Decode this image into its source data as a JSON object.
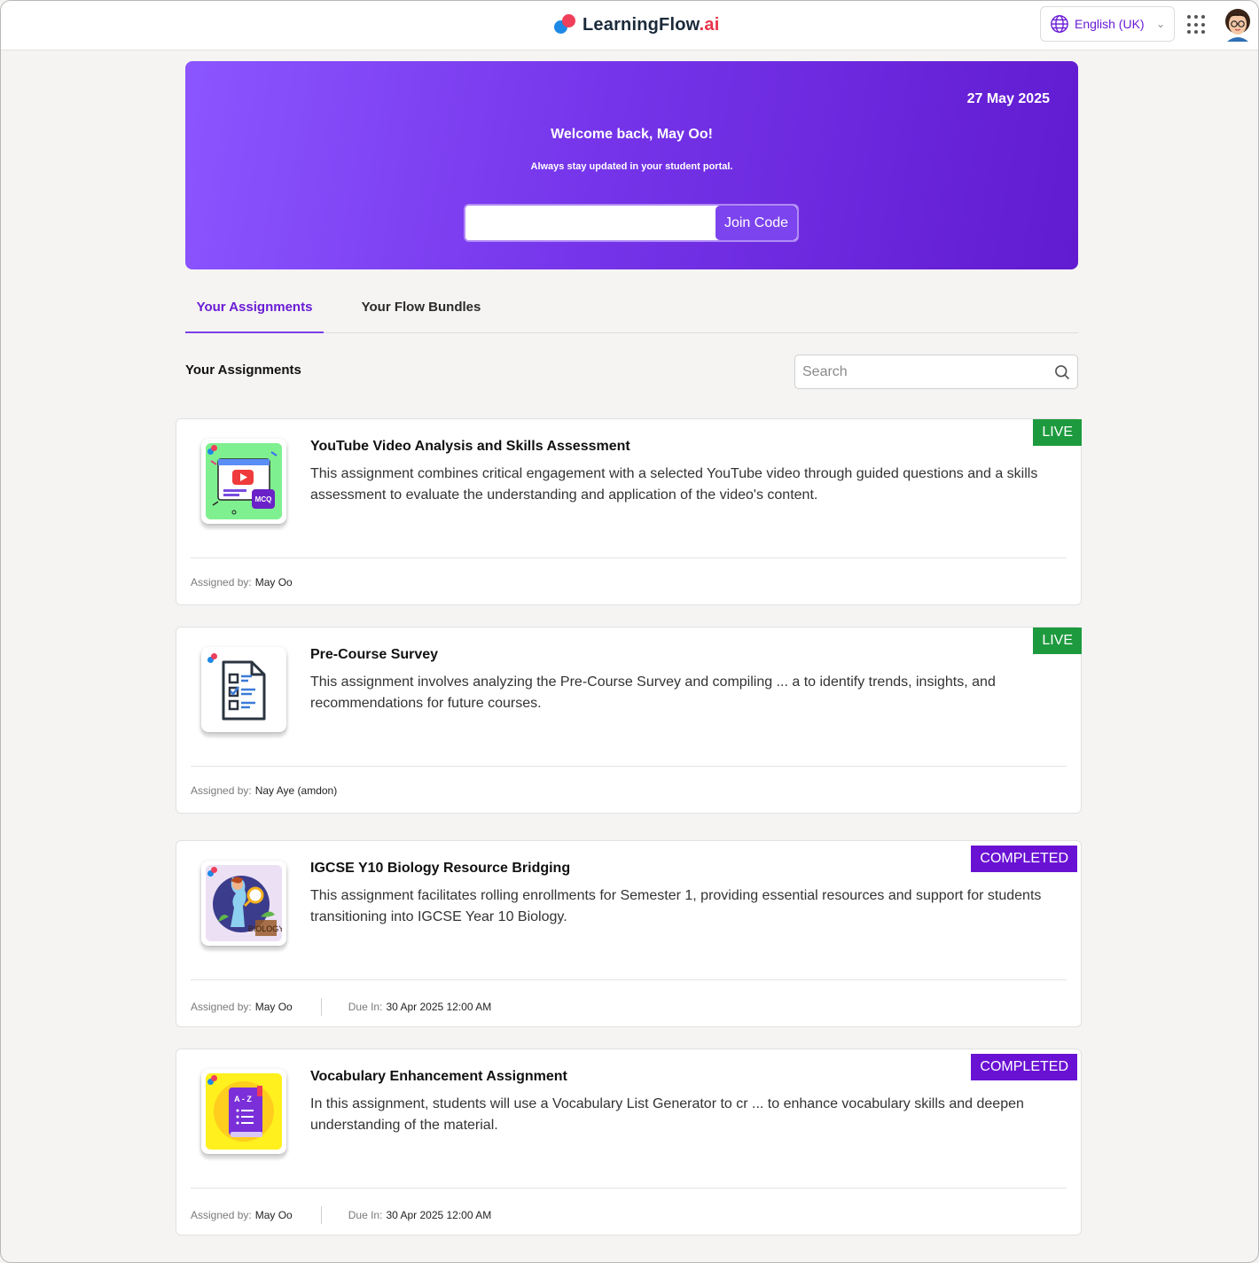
{
  "header": {
    "logo_main": "LearningFlow",
    "logo_suffix": ".ai",
    "language": "English (UK)"
  },
  "hero": {
    "date": "27 May 2025",
    "welcome": "Welcome back, May Oo!",
    "subtitle": "Always stay updated in your student portal.",
    "join_input_value": "",
    "join_button": "Join Code"
  },
  "tabs": [
    {
      "label": "Your Assignments",
      "active": true
    },
    {
      "label": "Your Flow Bundles",
      "active": false
    }
  ],
  "section": {
    "title": "Your Assignments",
    "search_placeholder": "Search"
  },
  "assignments": [
    {
      "title": "YouTube Video Analysis and Skills Assessment",
      "description": "This assignment combines critical engagement with a selected YouTube video through guided questions and a skills assessment to evaluate the understanding and application of the video's content.",
      "status": "LIVE",
      "assigned_by_label": "Assigned by:",
      "assigned_by": "May Oo",
      "thumbnail": "youtube-mcq-icon"
    },
    {
      "title": "Pre-Course Survey",
      "description": "This assignment involves analyzing the Pre-Course Survey and compiling ... a to identify trends, insights, and recommendations for future courses.",
      "status": "LIVE",
      "assigned_by_label": "Assigned by:",
      "assigned_by": "Nay Aye (amdon)",
      "thumbnail": "survey-checklist-icon"
    },
    {
      "title": "IGCSE Y10 Biology Resource Bridging",
      "description": "This assignment facilitates rolling enrollments for Semester 1, providing essential resources and support for students transitioning into IGCSE Year 10 Biology.",
      "status": "COMPLETED",
      "assigned_by_label": "Assigned by:",
      "assigned_by": "May Oo",
      "due_label": "Due In:",
      "due": "30 Apr 2025 12:00 AM",
      "thumbnail": "biology-icon"
    },
    {
      "title": "Vocabulary Enhancement Assignment",
      "description": "In this assignment, students will use a Vocabulary List Generator to cr ... to enhance vocabulary skills and deepen understanding of the material.",
      "status": "COMPLETED",
      "assigned_by_label": "Assigned by:",
      "assigned_by": "May Oo",
      "due_label": "Due In:",
      "due": "30 Apr 2025 12:00 AM",
      "thumbnail": "vocabulary-book-icon"
    }
  ],
  "colors": {
    "accent": "#6a1bd6",
    "live": "#1e9a3e",
    "completed": "#6a12d3"
  }
}
